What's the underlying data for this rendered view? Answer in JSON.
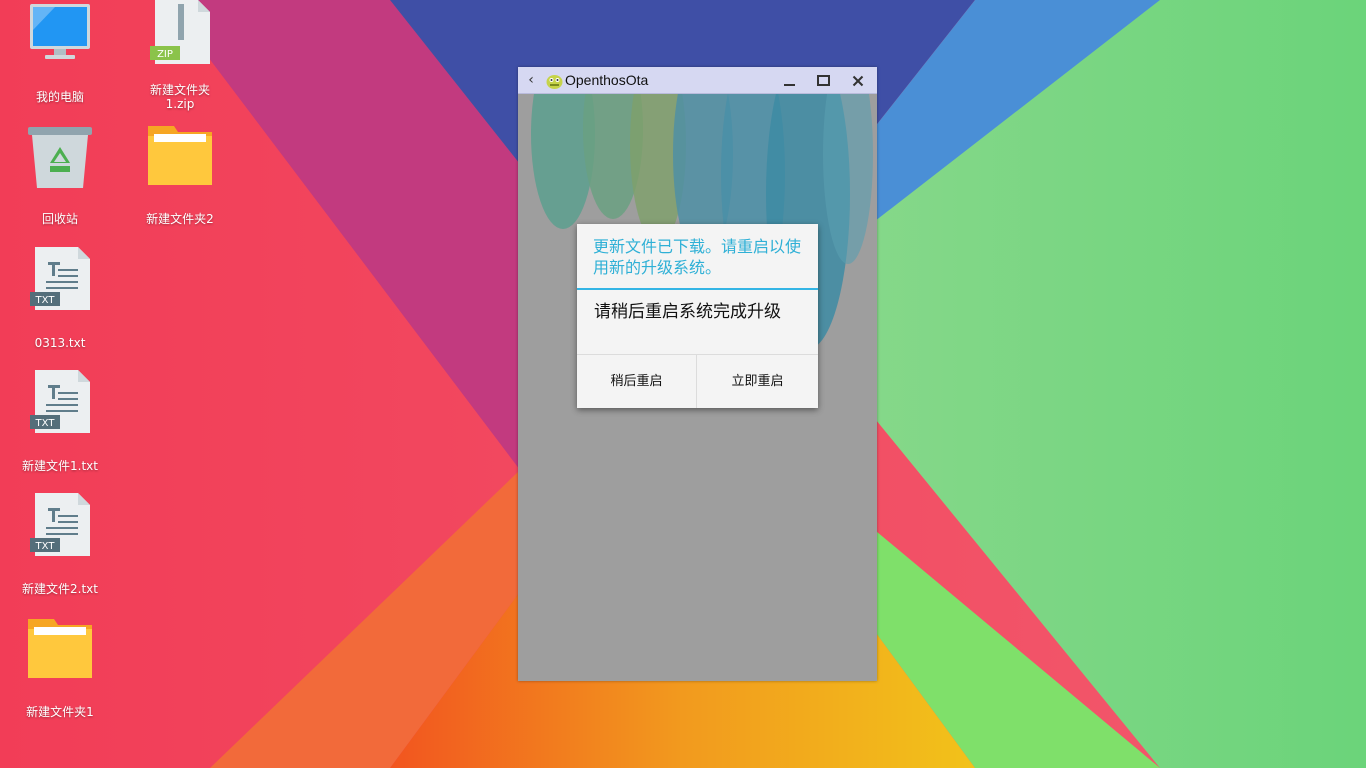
{
  "desktop": {
    "icons": [
      {
        "label": "我的电脑",
        "icon": "computer-icon"
      },
      {
        "label": "新建文件夹\n1.zip",
        "icon": "zip-file-icon",
        "badge": "ZIP"
      },
      {
        "label": "回收站",
        "icon": "recycle-bin-icon"
      },
      {
        "label": "新建文件夹2",
        "icon": "folder-icon"
      },
      {
        "label": "0313.txt",
        "icon": "txt-file-icon",
        "badge": "TXT"
      },
      {
        "label": "新建文件1.txt",
        "icon": "txt-file-icon",
        "badge": "TXT"
      },
      {
        "label": "新建文件2.txt",
        "icon": "txt-file-icon",
        "badge": "TXT"
      },
      {
        "label": "新建文件夹1",
        "icon": "folder-icon"
      }
    ]
  },
  "window": {
    "title": "OpenthosOta",
    "back_icon": "back-arrow-icon",
    "app_icon": "android-app-icon",
    "controls": [
      "minimize-icon",
      "maximize-icon",
      "close-icon"
    ]
  },
  "dialog": {
    "title": "更新文件已下载。请重启以使用新的升级系统。",
    "message": "请稍后重启系统完成升级",
    "later_button": "稍后重启",
    "now_button": "立即重启"
  },
  "colors": {
    "dialog_title": "#2fb0d6",
    "dialog_divider": "#33b5e5",
    "titlebar": "#d6d8f2",
    "window_bg": "#9e9e9e"
  }
}
